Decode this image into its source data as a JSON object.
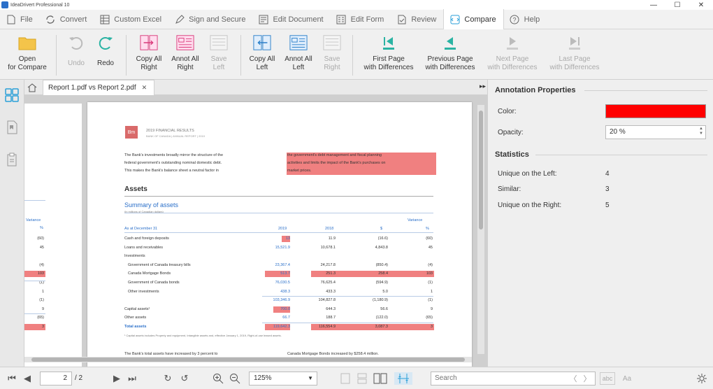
{
  "app": {
    "title": "IdeaDrivert Professional 10"
  },
  "window_controls": [
    "—",
    "☐",
    "✕"
  ],
  "menu": [
    {
      "label": "File",
      "icon": "file-icon"
    },
    {
      "label": "Convert",
      "icon": "convert-icon"
    },
    {
      "label": "Custom Excel",
      "icon": "table-icon"
    },
    {
      "label": "Sign and Secure",
      "icon": "pen-icon"
    },
    {
      "label": "Edit Document",
      "icon": "edit-doc-icon"
    },
    {
      "label": "Edit Form",
      "icon": "form-icon"
    },
    {
      "label": "Review",
      "icon": "review-icon"
    },
    {
      "label": "Compare",
      "icon": "compare-icon",
      "active": true
    },
    {
      "label": "Help",
      "icon": "help-icon"
    }
  ],
  "ribbon": {
    "open": {
      "line1": "Open",
      "line2": "for Compare"
    },
    "undo": "Undo",
    "redo": "Redo",
    "copy_all_right": {
      "line1": "Copy All",
      "line2": "Right"
    },
    "annot_all_right": {
      "line1": "Annot All",
      "line2": "Right"
    },
    "save_left": {
      "line1": "Save",
      "line2": "Left"
    },
    "copy_all_left": {
      "line1": "Copy All",
      "line2": "Left"
    },
    "annot_all_left": {
      "line1": "Annot All",
      "line2": "Left"
    },
    "save_right": {
      "line1": "Save",
      "line2": "Right"
    },
    "first_page": {
      "line1": "First Page",
      "line2": "with Differences"
    },
    "prev_page": {
      "line1": "Previous Page",
      "line2": "with Differences"
    },
    "next_page": {
      "line1": "Next Page",
      "line2": "with Differences"
    },
    "last_page": {
      "line1": "Last Page",
      "line2": "with Differences"
    }
  },
  "tab": {
    "label": "Report 1.pdf vs Report 2.pdf",
    "close": "✕",
    "collapse": "▸▸"
  },
  "document": {
    "logo_text": "Bm",
    "header_line1": "2019 FINANCIAL RESULTS",
    "header_line2": "BANK OF CANADA  |  ANNUAL REPORT  |  2019",
    "para_left": [
      "The Bank's investments broadly mirror the structure of the",
      "federal government's outstanding nominal domestic debt.",
      "This makes the Bank's balance sheet a neutral factor in"
    ],
    "para_right": [
      "the government's debt management and fiscal planning",
      "activities and limits the impact of the Bank's purchases on",
      "market prices."
    ],
    "section": "Assets",
    "table_title": "Summary of assets",
    "table_subtitle": "(in millions of Canadian dollars)",
    "variance_label": "Variance",
    "columns": [
      "As at December 31",
      "2019",
      "2018",
      "$",
      "%"
    ],
    "rows": [
      {
        "label": "Cash and foreign deposits",
        "c2019": "13",
        "c2018": "11.9",
        "d": "(16.6)",
        "p": "(60)",
        "hl2019": true
      },
      {
        "label": "Loans and receivables",
        "c2019": "15,521.9",
        "c2018": "10,678.1",
        "d": "4,843.8",
        "p": "45"
      },
      {
        "label": "Investments",
        "c2019": "",
        "c2018": "",
        "d": "",
        "p": ""
      },
      {
        "label": "Government of Canada treasury bills",
        "c2019": "23,367.4",
        "c2018": "24,217.8",
        "d": "(850.4)",
        "p": "(4)",
        "indent": true
      },
      {
        "label": "Canada Mortgage Bonds",
        "c2019": "513.7",
        "c2018": "251.3",
        "d": "258.4",
        "p": "103",
        "indent": true,
        "hlrow": true
      },
      {
        "label": "Government of Canada bonds",
        "c2019": "76,030.5",
        "c2018": "76,625.4",
        "d": "(594.9)",
        "p": "(1)",
        "indent": true
      },
      {
        "label": "Other investments",
        "c2019": "438.3",
        "c2018": "433.3",
        "d": "5.0",
        "p": "1",
        "indent": true
      },
      {
        "label": "",
        "c2019": "103,346.9",
        "c2018": "104,827.8",
        "d": "(1,180.9)",
        "p": "(1)",
        "total": true
      },
      {
        "label": "Capital assets¹",
        "c2019": "700.0",
        "c2018": "644.3",
        "d": "56.6",
        "p": "9",
        "hl2019": true
      },
      {
        "label": "Other assets",
        "c2019": "66.7",
        "c2018": "188.7",
        "d": "(122.0)",
        "p": "(65)"
      },
      {
        "label": "Total assets",
        "c2019": "119,642.3",
        "c2018": "116,554.9",
        "d": "3,087.3",
        "p": "3",
        "hlrow": true,
        "total": true
      }
    ],
    "footnote": "¹ Capital assets includes Property and equipment, Intangible assets and, effective January 1, 2019, Right-of-use leased assets.",
    "bottom_left": "The Bank's total assets have increased by 3 percent to",
    "bottom_right": "Canada Mortgage Bonds increased by $258.4 million.",
    "left_page": {
      "variance": "Variance",
      "pct": "%",
      "values": [
        "(60)",
        "45",
        "",
        "(4)",
        "103",
        "(1)",
        "1",
        "(1)",
        "9",
        "(65)",
        "3"
      ]
    }
  },
  "panel": {
    "annotation_title": "Annotation Properties",
    "color_label": "Color:",
    "color_value": "#ff0000",
    "opacity_label": "Opacity:",
    "opacity_value": "20 %",
    "stats_title": "Statistics",
    "unique_left_label": "Unique on the Left:",
    "unique_left": "4",
    "similar_label": "Similar:",
    "similar": "3",
    "unique_right_label": "Unique on the Right:",
    "unique_right": "5"
  },
  "status": {
    "page_current": "2",
    "page_total": "/ 2",
    "zoom": "125%",
    "search_placeholder": "Search",
    "find_buttons": [
      "〈",
      "〉"
    ],
    "case_label": "abc",
    "font_label": "Aa"
  }
}
